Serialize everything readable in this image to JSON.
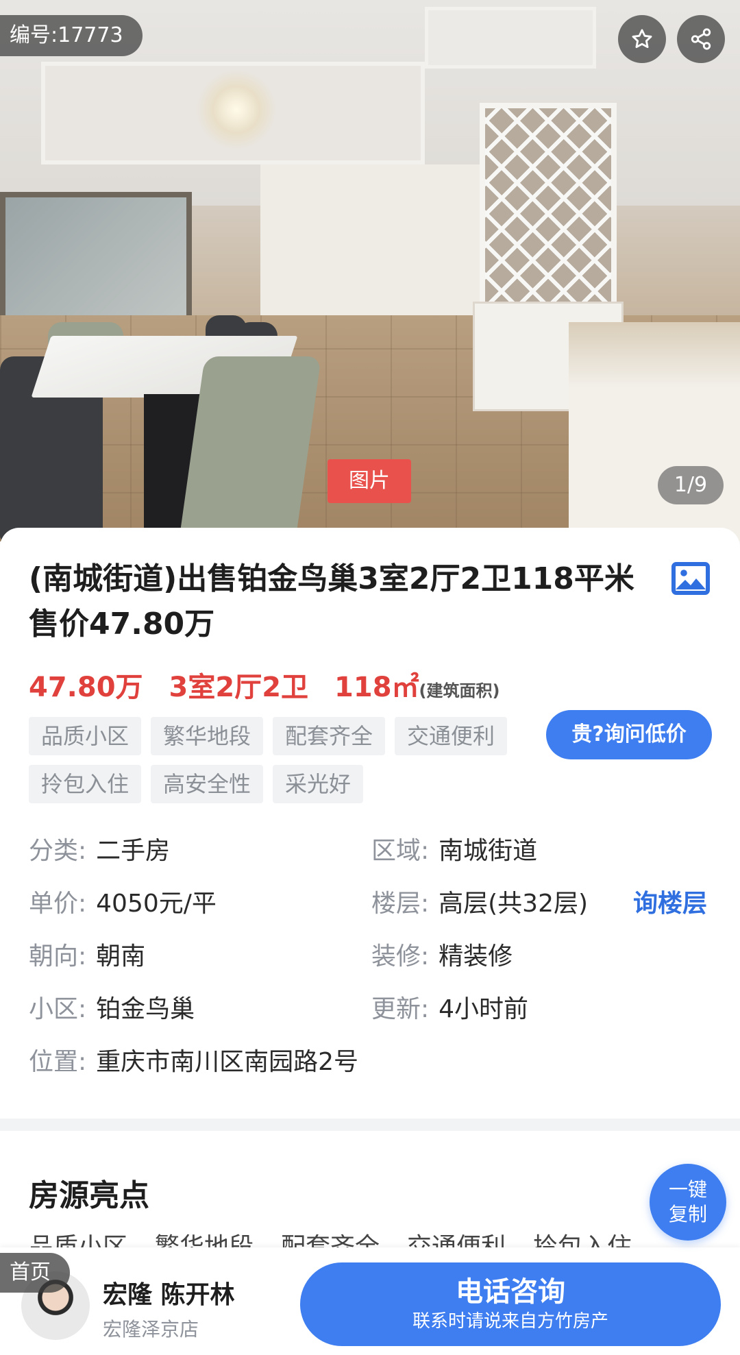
{
  "listing": {
    "id_label": "编号:17773",
    "photo_tag": "图片",
    "photo_counter": "1/9",
    "title": "(南城街道)出售铂金鸟巢3室2厅2卫118平米 售价47.80万",
    "price": "47.80万",
    "layout": "3室2厅2卫",
    "area": "118㎡",
    "area_note": "(建筑面积)",
    "tags": [
      "品质小区",
      "繁华地段",
      "配套齐全",
      "交通便利",
      "拎包入住",
      "高安全性",
      "采光好"
    ],
    "ask_low_price": "贵?询问低价"
  },
  "details": {
    "category": {
      "label": "分类:",
      "value": "二手房"
    },
    "region": {
      "label": "区域:",
      "value": "南城街道"
    },
    "unit_price": {
      "label": "单价:",
      "value": "4050元/平"
    },
    "floor": {
      "label": "楼层:",
      "value": "高层(共32层)"
    },
    "ask_floor": "询楼层",
    "orientation": {
      "label": "朝向:",
      "value": "朝南"
    },
    "decoration": {
      "label": "装修:",
      "value": "精装修"
    },
    "community": {
      "label": "小区:",
      "value": "铂金鸟巢"
    },
    "updated": {
      "label": "更新:",
      "value": "4小时前"
    },
    "location": {
      "label": "位置:",
      "value": "重庆市南川区南园路2号"
    }
  },
  "highlights": {
    "title": "房源亮点",
    "items": [
      "品质小区",
      "繁华地段",
      "配套齐全",
      "交通便利",
      "拎包入住"
    ],
    "copy_line1": "一键",
    "copy_line2": "复制"
  },
  "bottom_bar": {
    "home_label": "首页",
    "agent_name": "宏隆 陈开林",
    "agent_store": "宏隆泽京店",
    "call_label": "电话咨询",
    "call_note": "联系时请说来自方竹房产"
  },
  "colors": {
    "accent_blue": "#3e7ef0",
    "price_red": "#e0413c",
    "tag_red": "#e9524c"
  },
  "icons": [
    "star-icon",
    "share-icon",
    "gallery-icon"
  ]
}
